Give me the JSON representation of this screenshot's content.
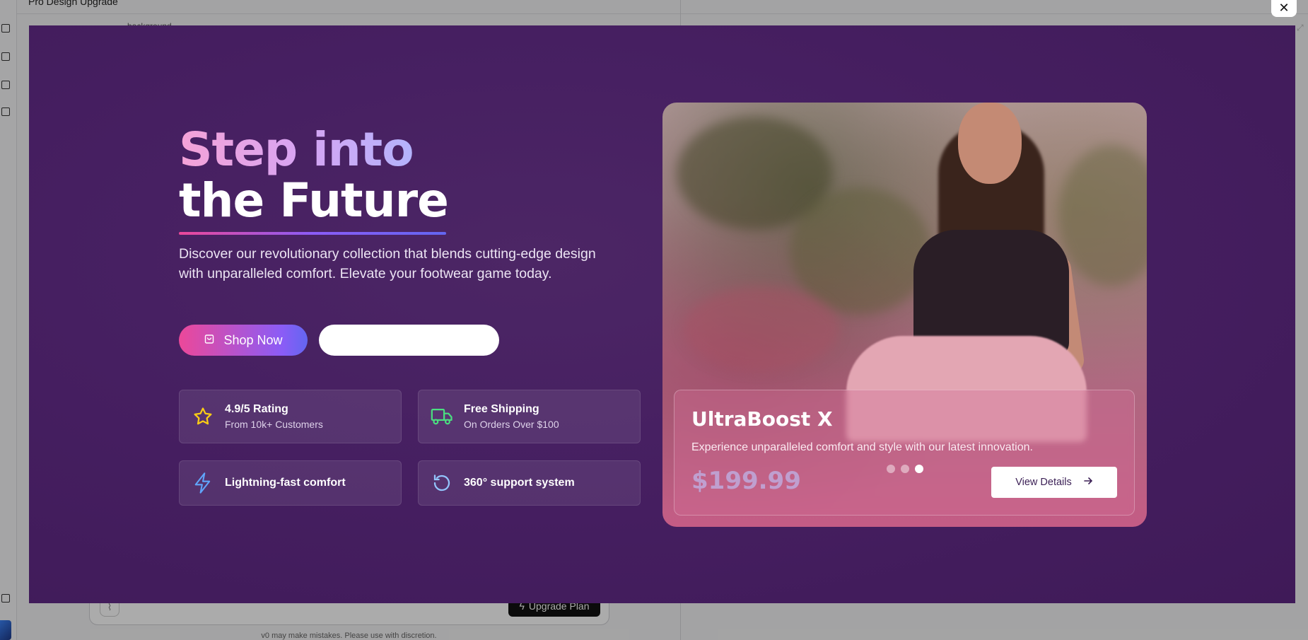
{
  "background_app": {
    "title": "Pro Design Upgrade",
    "fragment": "background",
    "upgrade_label": "Upgrade Plan",
    "disclaimer": "v0 may make mistakes. Please use with discretion."
  },
  "window": {
    "close_label": "✕",
    "expand_label": "⤢"
  },
  "hero": {
    "headline_line1": "Step into",
    "headline_line2": "the Future",
    "description": "Discover our revolutionary collection that blends cutting-edge design with unparalleled comfort. Elevate your footwear game today.",
    "primary_button": "Shop Now",
    "secondary_button": ""
  },
  "features": [
    {
      "title": "4.9/5 Rating",
      "subtitle": "From 10k+ Customers",
      "icon": "star-icon",
      "color": "#facc15"
    },
    {
      "title": "Free Shipping",
      "subtitle": "On Orders Over $100",
      "icon": "truck-icon",
      "color": "#4ade80"
    },
    {
      "title": "Lightning-fast comfort",
      "subtitle": "",
      "icon": "lightning-icon",
      "color": "#60a5fa"
    },
    {
      "title": "360° support system",
      "subtitle": "",
      "icon": "rotate-icon",
      "color": "#93c5fd"
    }
  ],
  "product": {
    "name": "UltraBoost X",
    "description": "Experience unparalleled comfort and style with our latest innovation.",
    "price": "$199.99",
    "details_button": "View Details",
    "carousel_active_index": 3,
    "carousel_total": 3
  },
  "colors": {
    "background": "#461f61",
    "accent_pink": "#ec4899",
    "accent_violet": "#8b5cf6"
  }
}
